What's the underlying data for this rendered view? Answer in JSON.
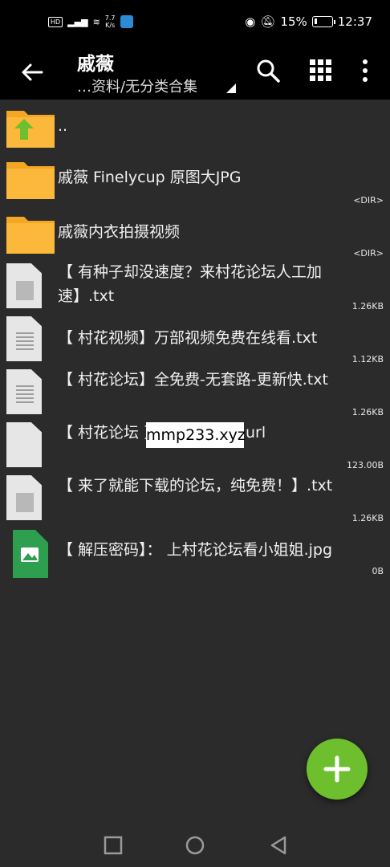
{
  "status_bar": {
    "network_badge": "HD",
    "speed_value": "7.7",
    "speed_unit": "K/s",
    "battery": "15%",
    "battery_level": 0.15,
    "time": "12:37"
  },
  "header": {
    "title": "戚薇",
    "subtitle": "…资料/无分类合集",
    "icons": [
      "back-arrow-icon",
      "search-icon",
      "grid-view-icon",
      "more-vert-icon"
    ]
  },
  "files": [
    {
      "label": "..",
      "type": "parent",
      "meta": ""
    },
    {
      "label": "戚薇 Finelycup 原图大JPG",
      "type": "folder",
      "meta": "<DIR>"
    },
    {
      "label": "戚薇内衣拍摄视频",
      "type": "folder",
      "meta": "<DIR>"
    },
    {
      "label": "【 有种子却没速度？来村花论坛人工加速】.txt",
      "type": "doc",
      "meta": "1.26KB"
    },
    {
      "label": "【 村花视频】万部视频免费在线看.txt",
      "type": "doc-lines",
      "meta": "1.12KB"
    },
    {
      "label": "【 村花论坛】全免费-无套路-更新快.txt",
      "type": "doc-lines",
      "meta": "1.26KB"
    },
    {
      "label": "【 村花论坛 页】-点此打开.url",
      "type": "doc-blank",
      "meta": "123.00B"
    },
    {
      "label": "【 来了就能下载的论坛，纯免费！】.txt",
      "type": "doc",
      "meta": "1.26KB"
    },
    {
      "label": "【 解压密码】： 上村花论坛看小姐姐.jpg",
      "type": "image",
      "meta": "0B"
    }
  ],
  "overlay": {
    "watermark": "mmp233.xyz"
  },
  "fab": {
    "icon": "plus-icon"
  },
  "nav": {
    "icons": [
      "recent-apps-icon",
      "home-icon",
      "back-icon"
    ]
  },
  "colors": {
    "background": "#2b2b2b",
    "header": "#000000",
    "folder": "#f5a623",
    "parent_arrow": "#6dbf2e",
    "image_file": "#2e9e4f",
    "fab": "#6dbf2e"
  }
}
